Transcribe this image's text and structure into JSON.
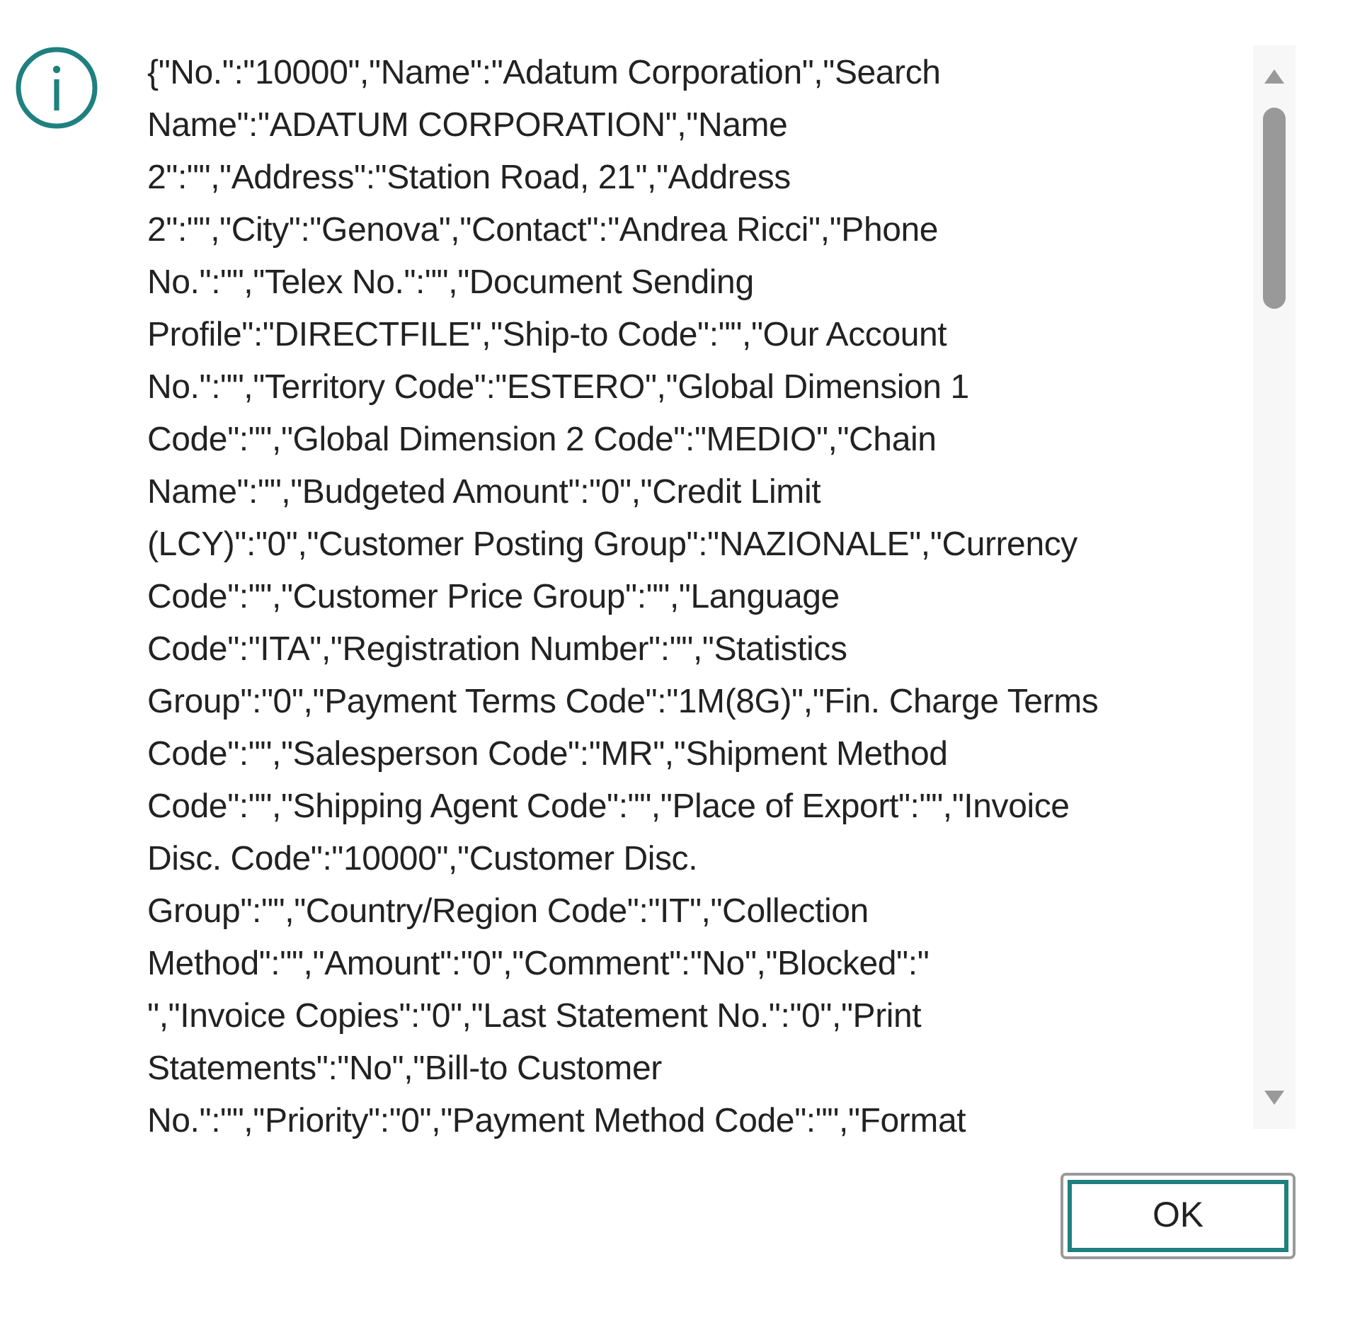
{
  "dialog": {
    "message_lines": [
      "{\"No.\":\"10000\",\"Name\":\"Adatum Corporation\",\"Search",
      "Name\":\"ADATUM CORPORATION\",\"Name",
      "2\":\"\",\"Address\":\"Station Road, 21\",\"Address",
      "2\":\"\",\"City\":\"Genova\",\"Contact\":\"Andrea Ricci\",\"Phone",
      "No.\":\"\",\"Telex No.\":\"\",\"Document Sending",
      "Profile\":\"DIRECTFILE\",\"Ship-to Code\":\"\",\"Our Account",
      "No.\":\"\",\"Territory Code\":\"ESTERO\",\"Global Dimension 1",
      "Code\":\"\",\"Global Dimension 2 Code\":\"MEDIO\",\"Chain",
      "Name\":\"\",\"Budgeted Amount\":\"0\",\"Credit Limit",
      "(LCY)\":\"0\",\"Customer Posting Group\":\"NAZIONALE\",\"Currency",
      "Code\":\"\",\"Customer Price Group\":\"\",\"Language",
      "Code\":\"ITA\",\"Registration Number\":\"\",\"Statistics",
      "Group\":\"0\",\"Payment Terms Code\":\"1M(8G)\",\"Fin. Charge Terms",
      "Code\":\"\",\"Salesperson Code\":\"MR\",\"Shipment Method",
      "Code\":\"\",\"Shipping Agent Code\":\"\",\"Place of Export\":\"\",\"Invoice",
      "Disc. Code\":\"10000\",\"Customer Disc.",
      "Group\":\"\",\"Country/Region Code\":\"IT\",\"Collection",
      "Method\":\"\",\"Amount\":\"0\",\"Comment\":\"No\",\"Blocked\":\"",
      "\",\"Invoice Copies\":\"0\",\"Last Statement No.\":\"0\",\"Print",
      "Statements\":\"No\",\"Bill-to Customer",
      "No.\":\"\",\"Priority\":\"0\",\"Payment Method Code\":\"\",\"Format"
    ],
    "buttons": [
      {
        "label": "OK",
        "focused": true
      }
    ]
  }
}
